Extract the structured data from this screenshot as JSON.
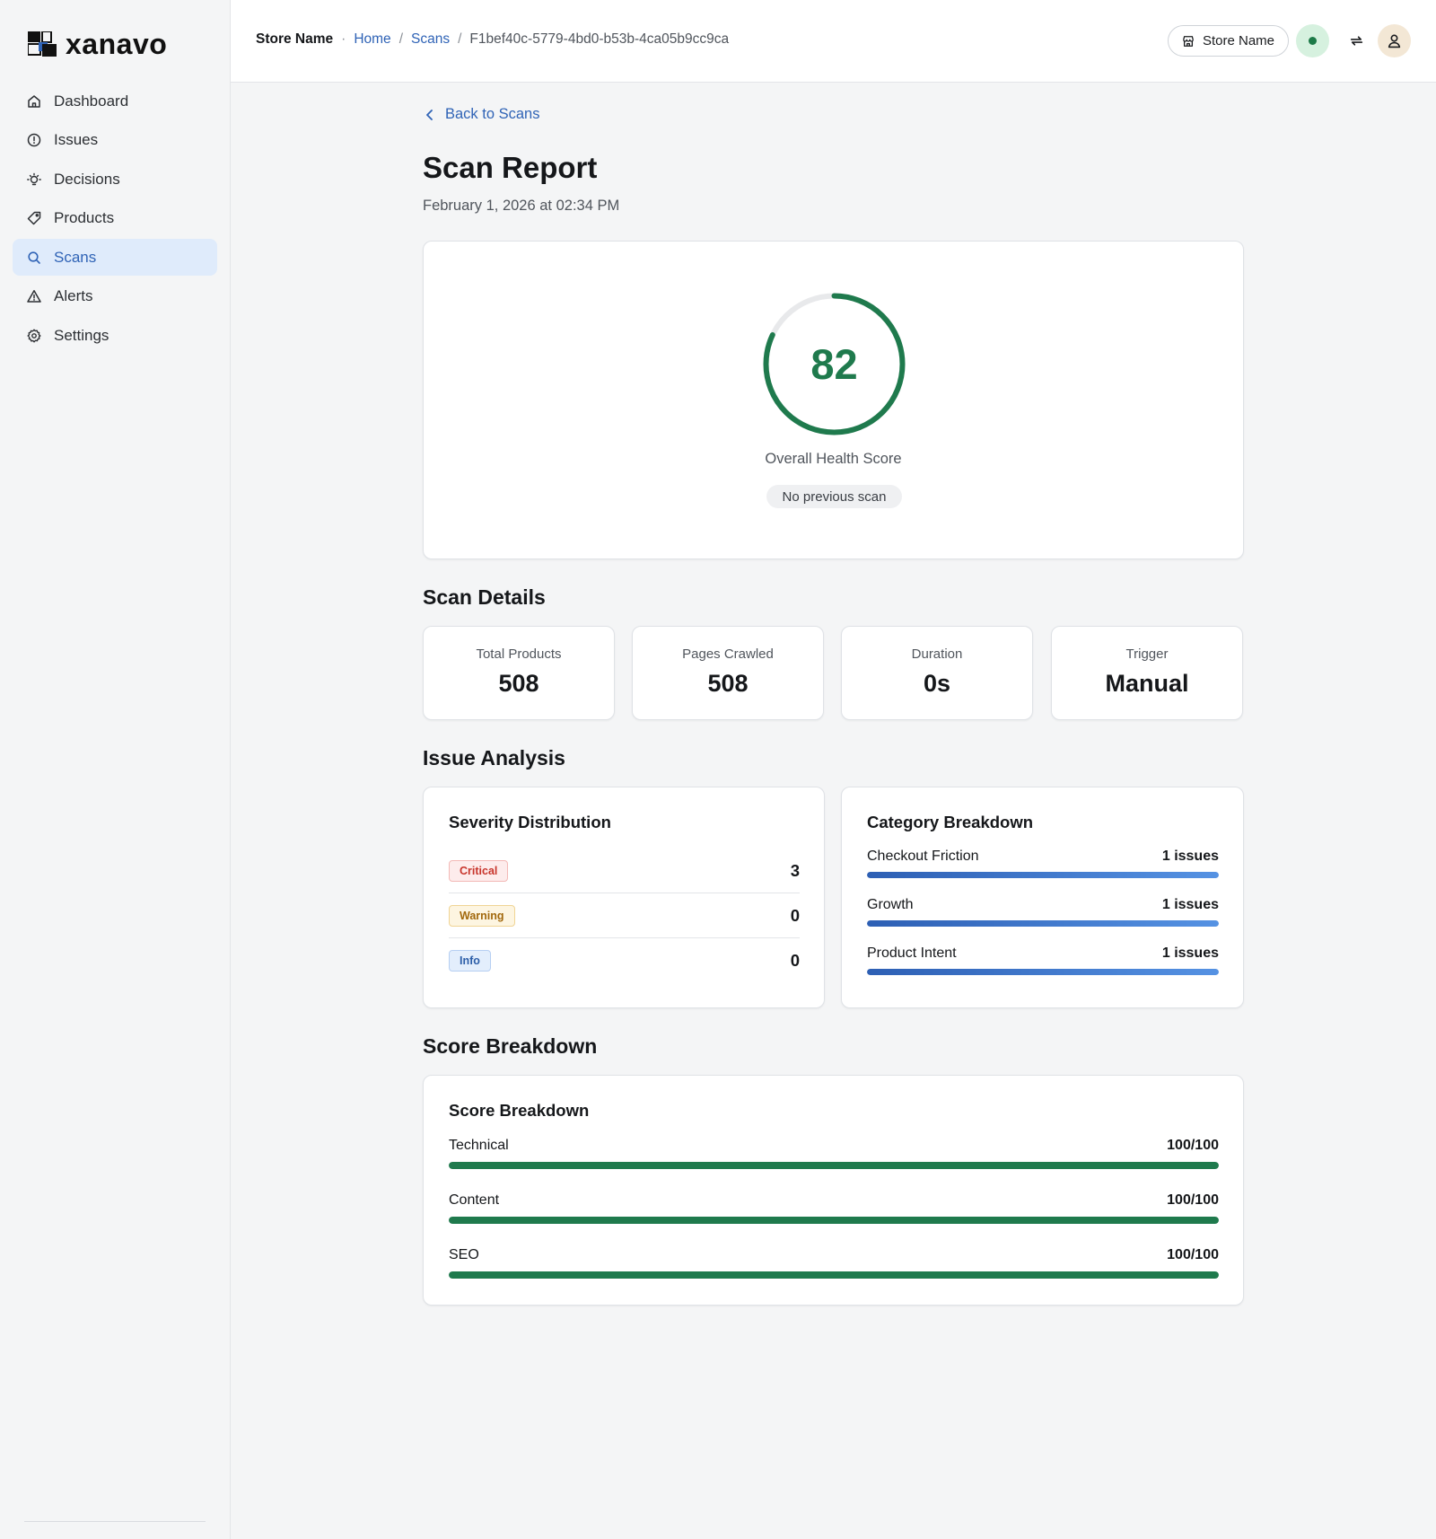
{
  "brand": {
    "name": "xanavo"
  },
  "sidebar": {
    "items": [
      {
        "label": "Dashboard",
        "icon": "home-icon"
      },
      {
        "label": "Issues",
        "icon": "alert-circle-icon"
      },
      {
        "label": "Decisions",
        "icon": "lightbulb-icon"
      },
      {
        "label": "Products",
        "icon": "tag-icon"
      },
      {
        "label": "Scans",
        "icon": "search-icon",
        "active": true
      },
      {
        "label": "Alerts",
        "icon": "warning-triangle-icon"
      },
      {
        "label": "Settings",
        "icon": "gear-icon"
      }
    ]
  },
  "header": {
    "store_name": "Store Name",
    "breadcrumb": {
      "home": "Home",
      "scans": "Scans",
      "current": "F1bef40c-5779-4bd0-b53b-4ca05b9cc9ca"
    },
    "store_button_label": "Store Name",
    "status": "online"
  },
  "main": {
    "back_link": "Back to Scans",
    "title": "Scan Report",
    "subtitle": "February 1, 2026 at 02:34 PM",
    "health": {
      "score": 82,
      "max": 100,
      "label": "Overall Health Score",
      "comparison": "No previous scan",
      "color": "#1f7a4d"
    },
    "scan_details": {
      "title": "Scan Details",
      "stats": [
        {
          "label": "Total Products",
          "value": "508"
        },
        {
          "label": "Pages Crawled",
          "value": "508"
        },
        {
          "label": "Duration",
          "value": "0s"
        },
        {
          "label": "Trigger",
          "value": "Manual"
        }
      ]
    },
    "issue_analysis": {
      "title": "Issue Analysis",
      "severity": {
        "title": "Severity Distribution",
        "rows": [
          {
            "label": "Critical",
            "count": "3",
            "color": "#c8352c"
          },
          {
            "label": "Warning",
            "count": "0",
            "color": "#a2680c"
          },
          {
            "label": "Info",
            "count": "0",
            "color": "#2c5ea8"
          }
        ]
      },
      "categories": {
        "title": "Category Breakdown",
        "rows": [
          {
            "label": "Checkout Friction",
            "value": "1 issues",
            "fill": 1.0
          },
          {
            "label": "Growth",
            "value": "1 issues",
            "fill": 1.0
          },
          {
            "label": "Product Intent",
            "value": "1 issues",
            "fill": 1.0
          }
        ]
      }
    },
    "score_breakdown": {
      "section_title": "Score Breakdown",
      "card_title": "Score Breakdown",
      "rows": [
        {
          "label": "Technical",
          "value": "100/100",
          "fill": 1.0
        },
        {
          "label": "Content",
          "value": "100/100",
          "fill": 1.0
        },
        {
          "label": "SEO",
          "value": "100/100",
          "fill": 1.0
        }
      ]
    }
  }
}
